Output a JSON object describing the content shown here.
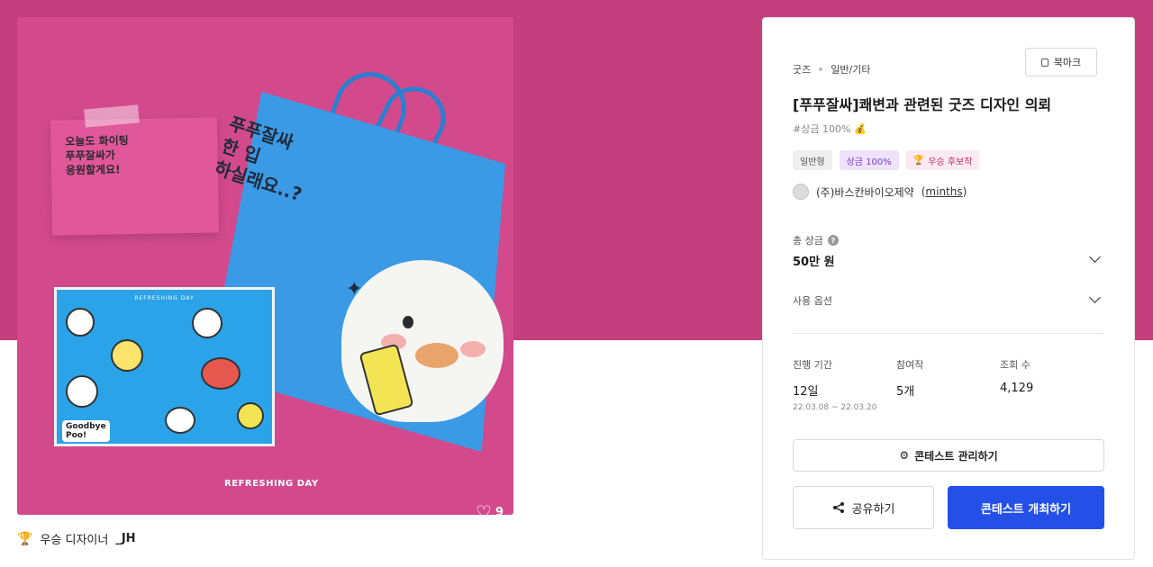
{
  "artwork": {
    "banner_text": "오늘도 화이팅\n푸푸잘싸가\n응원할게요!",
    "bag_text": "푸푸잘싸\n한 입\n하실래요..?",
    "sheet_title": "REFRESHING DAY",
    "sticker_text": "Goodbye\nPoo!",
    "brand_text": "REFRESHING DAY",
    "like_count": "9",
    "colors": {
      "background": "#d24a8c",
      "bag": "#3a9ae6",
      "sheet": "#2aa3e8"
    }
  },
  "winner": {
    "label": "우승 디자이너",
    "name": "_JH",
    "icon": "trophy-icon"
  },
  "panel": {
    "category": "굿즈",
    "subcategory": "일반/기타",
    "bookmark_label": "북마크",
    "title": "[푸푸잘싸]쾌변과 관련된 굿즈 디자인 의뢰",
    "prize_tag": "#상금 100%",
    "badges": {
      "type": "일반형",
      "prize": "상금 100%",
      "winner": "우승 후보작"
    },
    "company": "(주)바스칸바이오제약",
    "company_id": "minths",
    "total_prize_label": "총 상금",
    "total_prize_value": "50만 원",
    "usage_label": "사용 옵션",
    "stats": {
      "period_label": "진행 기간",
      "period_value": "12일",
      "period_range": "22.03.08 ~ 22.03.20",
      "entries_label": "참여작",
      "entries_value": "5개",
      "views_label": "조회 수",
      "views_value": "4,129"
    },
    "manage_label": "콘테스트 관리하기",
    "share_label": "공유하기",
    "host_label": "콘테스트 개최하기"
  },
  "colors": {
    "hero": "#c53e7e",
    "primary_button": "#2450e8"
  }
}
